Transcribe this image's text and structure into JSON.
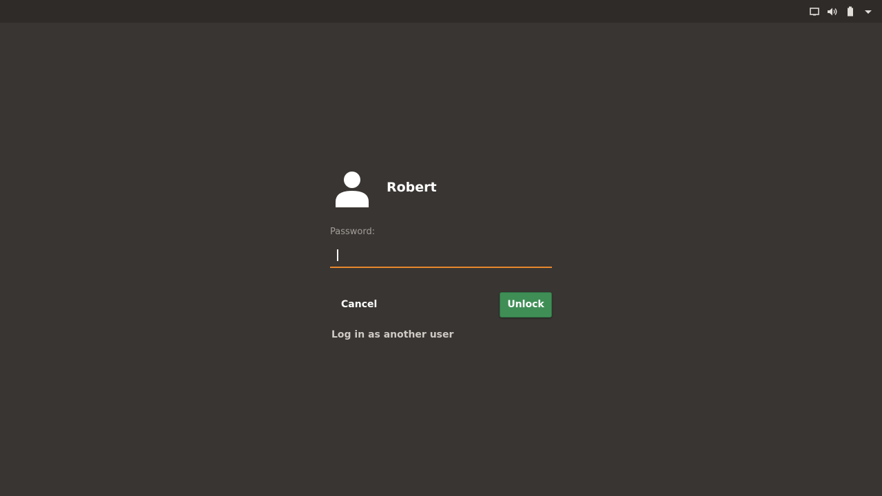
{
  "panel": {
    "icons": [
      "display-icon",
      "volume-icon",
      "battery-icon",
      "menu-arrow-icon"
    ]
  },
  "unlock": {
    "user_name": "Robert",
    "password_label": "Password:",
    "password_value": "",
    "cancel_label": "Cancel",
    "unlock_label": "Unlock",
    "other_user_label": "Log in as another user"
  },
  "colors": {
    "background": "#393532",
    "panel": "#2e2b28",
    "accent_focus": "#e8892f",
    "unlock_button": "#3f8e56"
  }
}
